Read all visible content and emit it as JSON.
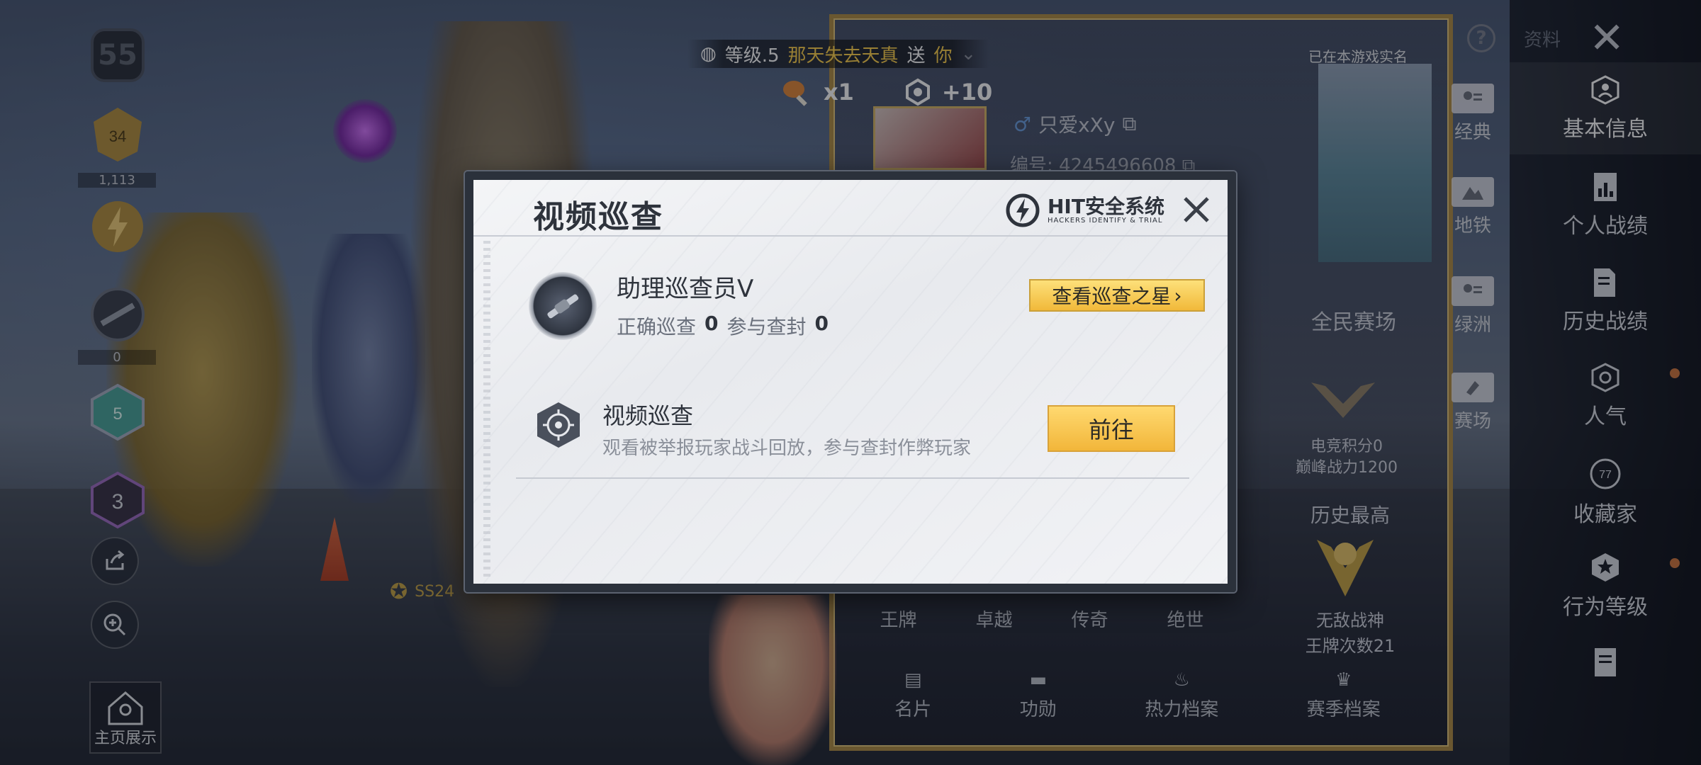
{
  "ticker": {
    "level": "等级.5",
    "sender": "那天失去天真",
    "action": "送",
    "target": "你"
  },
  "gifts": [
    {
      "icon": "drumstick-icon",
      "value": "x1"
    },
    {
      "icon": "popularity-icon",
      "value": "+10"
    }
  ],
  "left_panel": {
    "level": "55",
    "rank1_value": "34",
    "rank1_count": "1,113",
    "rank3_count": "0",
    "badge_5": "5",
    "badge_3": "3",
    "home_show": "主页展示"
  },
  "profile": {
    "verified": "已在本游戏实名",
    "name": "只爱xXy",
    "id": "编号: 4245496608",
    "arena": "全民赛场",
    "esports_score": "电竞积分0",
    "peak_power": "巅峰战力1200",
    "history_high": "历史最高",
    "title": "无敌战神",
    "ace_count": "王牌次数21",
    "season": "SS24",
    "tiers": [
      "王牌",
      "卓越",
      "传奇",
      "绝世"
    ],
    "bottom_tabs": [
      "名片",
      "功勋",
      "热力档案",
      "赛季档案"
    ]
  },
  "maps": [
    "经典",
    "地铁",
    "绿洲",
    "赛场"
  ],
  "sidebar": {
    "top_label": "资料",
    "items": [
      {
        "label": "基本信息",
        "active": true
      },
      {
        "label": "个人战绩"
      },
      {
        "label": "历史战绩"
      },
      {
        "label": "人气",
        "dot": true
      },
      {
        "label": "收藏家",
        "badge": "77"
      },
      {
        "label": "行为等级",
        "dot": true
      }
    ]
  },
  "modal": {
    "title": "视频巡查",
    "logo_title": "HIT安全系统",
    "logo_subtitle": "HACKERS IDENTIFY & TRIAL",
    "patrol_name": "助理巡查员V",
    "correct_label": "正确巡查",
    "correct_value": "0",
    "join_label": "参与查封",
    "join_value": "0",
    "star_button": "查看巡查之星",
    "feature_title": "视频巡查",
    "feature_desc": "观看被举报玩家战斗回放，参与查封作弊玩家",
    "go_button": "前往"
  }
}
